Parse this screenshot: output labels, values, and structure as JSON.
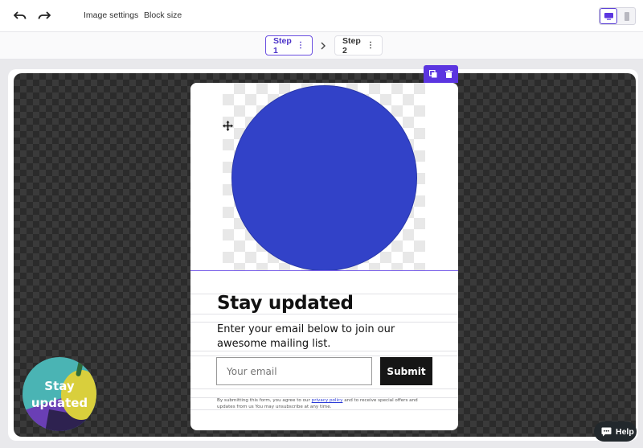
{
  "toolbar": {
    "undo_icon": "undo-icon",
    "redo_icon": "redo-icon",
    "image_settings": "Image settings",
    "block_size": "Block size",
    "devices": [
      "desktop-icon",
      "mobile-icon"
    ],
    "active_device": "desktop"
  },
  "steps": {
    "step1": "Step 1",
    "step2": "Step 2",
    "active": "Step 1"
  },
  "block_actions": [
    "duplicate-icon",
    "delete-icon"
  ],
  "popup": {
    "image_shape": "circle",
    "image_color": "#3242c8",
    "title": "Stay updated",
    "subtitle": "Enter your email below to join our awesome mailing list.",
    "email_placeholder": "Your email",
    "submit_label": "Submit",
    "legal_before": "By submitting this form, you agree to our ",
    "legal_link": "privacy policy",
    "legal_after": " and to receive special offers and updates from us You may unsubscribe at any time."
  },
  "teaser": {
    "line1": "Stay",
    "line2": "updated"
  },
  "help": {
    "label": "Help"
  },
  "colors": {
    "accent": "#5b35e0",
    "canvas_dark": "#2b2b2b",
    "submit_bg": "#161616",
    "help_bg": "#22282c"
  }
}
